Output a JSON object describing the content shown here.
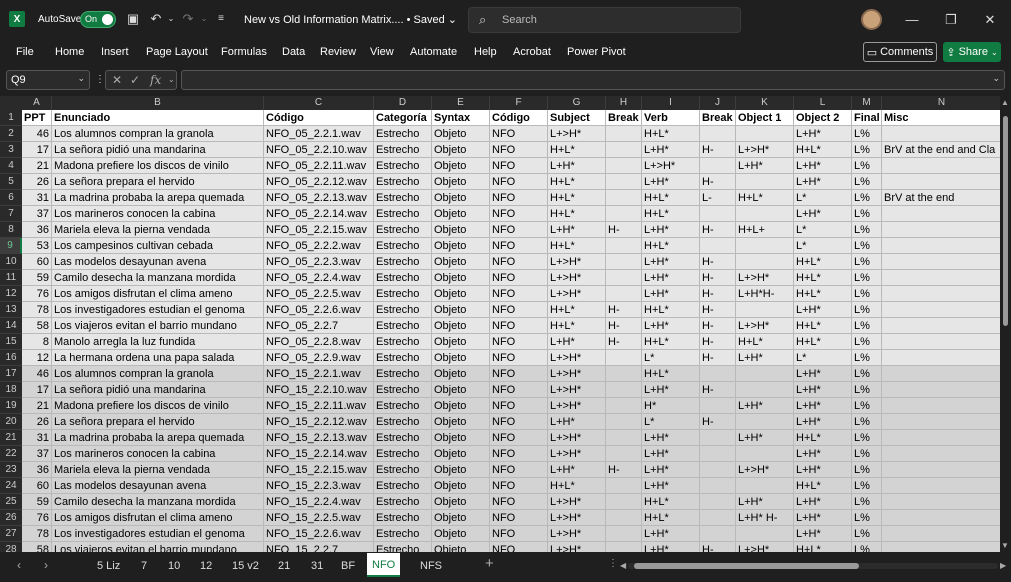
{
  "titlebar": {
    "app_icon": "X",
    "autosave_label": "AutoSave",
    "autosave_state": "On",
    "doc_title": "New vs Old Information Matrix.... • Saved",
    "search_placeholder": "Search"
  },
  "menu": [
    "File",
    "Home",
    "Insert",
    "Page Layout",
    "Formulas",
    "Data",
    "Review",
    "View",
    "Automate",
    "Help",
    "Acrobat",
    "Power Pivot"
  ],
  "actions": {
    "comments": "Comments",
    "share": "Share"
  },
  "formula_bar": {
    "name_box": "Q9",
    "fx": "fx",
    "formula": ""
  },
  "columns": [
    "A",
    "B",
    "C",
    "D",
    "E",
    "F",
    "G",
    "H",
    "I",
    "J",
    "K",
    "L",
    "M",
    "N"
  ],
  "headers": [
    "PPT",
    "Enunciado",
    "Código",
    "Categoría",
    "Syntax",
    "Código",
    "Subject",
    "Break",
    "Verb",
    "Break",
    "Object 1",
    "Object 2",
    "Final",
    "Misc"
  ],
  "rows": [
    [
      "46",
      "Los alumnos compran la granola",
      "NFO_05_2.2.1.wav",
      "Estrecho",
      "Objeto",
      "NFO",
      "L+>H*",
      "",
      "H+L*",
      "",
      "",
      "L+H*",
      "L%",
      ""
    ],
    [
      "17",
      "La señora pidió una mandarina",
      "NFO_05_2.2.10.wav",
      "Estrecho",
      "Objeto",
      "NFO",
      "H+L*",
      "",
      "L+H*",
      "H-",
      "L+>H*",
      "H+L*",
      "L%",
      "BrV at the end and Cla"
    ],
    [
      "21",
      "Madona prefiere los discos de vinilo",
      "NFO_05_2.2.11.wav",
      "Estrecho",
      "Objeto",
      "NFO",
      "L+H*",
      "",
      "L+>H*",
      "",
      "L+H*",
      "L+H*",
      "L%",
      ""
    ],
    [
      "26",
      "La señora prepara el hervido",
      "NFO_05_2.2.12.wav",
      "Estrecho",
      "Objeto",
      "NFO",
      "H+L*",
      "",
      "L+H*",
      "H-",
      "",
      "L+H*",
      "L%",
      ""
    ],
    [
      "31",
      "La madrina probaba la arepa quemada",
      "NFO_05_2.2.13.wav",
      "Estrecho",
      "Objeto",
      "NFO",
      "H+L*",
      "",
      "H+L*",
      "L-",
      "H+L*",
      "L*",
      "L%",
      "BrV  at the end"
    ],
    [
      "37",
      "Los marineros conocen la cabina",
      "NFO_05_2.2.14.wav",
      "Estrecho",
      "Objeto",
      "NFO",
      "H+L*",
      "",
      "H+L*",
      "",
      "",
      "L+H*",
      "L%",
      ""
    ],
    [
      "36",
      "Mariela eleva la pierna vendada",
      "NFO_05_2.2.15.wav",
      "Estrecho",
      "Objeto",
      "NFO",
      "L+H*",
      "H-",
      "L+H*",
      "H-",
      "H+L+",
      "L*",
      "L%",
      ""
    ],
    [
      "53",
      "Los campesinos cultivan cebada",
      "NFO_05_2.2.2.wav",
      "Estrecho",
      "Objeto",
      "NFO",
      "H+L*",
      "",
      "H+L*",
      "",
      "",
      "L*",
      "L%",
      ""
    ],
    [
      "60",
      "Las modelos desayunan avena",
      "NFO_05_2.2.3.wav",
      "Estrecho",
      "Objeto",
      "NFO",
      "L+>H*",
      "",
      "L+H*",
      "H-",
      "",
      "H+L*",
      "L%",
      ""
    ],
    [
      "59",
      "Camilo desecha la manzana mordida",
      "NFO_05_2.2.4.wav",
      "Estrecho",
      "Objeto",
      "NFO",
      "L+>H*",
      "",
      "L+H*",
      "H-",
      "L+>H*",
      "H+L*",
      "L%",
      ""
    ],
    [
      "76",
      "Los amigos disfrutan el clima ameno",
      "NFO_05_2.2.5.wav",
      "Estrecho",
      "Objeto",
      "NFO",
      "L+>H*",
      "",
      "L+H*",
      "H-",
      "L+H*H-",
      "H+L*",
      "L%",
      ""
    ],
    [
      "78",
      "Los investigadores estudian el genoma",
      "NFO_05_2.2.6.wav",
      "Estrecho",
      "Objeto",
      "NFO",
      "H+L*",
      "H-",
      "H+L*",
      "H-",
      "",
      "L+H*",
      "L%",
      ""
    ],
    [
      "58",
      "Los viajeros evitan el barrio mundano",
      "NFO_05_2.2.7",
      "Estrecho",
      "Objeto",
      "NFO",
      "H+L*",
      "H-",
      "L+H*",
      "H-",
      "L+>H*",
      "H+L*",
      "L%",
      ""
    ],
    [
      "8",
      "Manolo arregla la luz fundida",
      "NFO_05_2.2.8.wav",
      "Estrecho",
      "Objeto",
      "NFO",
      "L+H*",
      "H-",
      "H+L*",
      "H-",
      "H+L*",
      "H+L*",
      "L%",
      ""
    ],
    [
      "12",
      "La hermana ordena una papa salada",
      "NFO_05_2.2.9.wav",
      "Estrecho",
      "Objeto",
      "NFO",
      "L+>H*",
      "",
      "L*",
      "H-",
      "L+H*",
      "L*",
      "L%",
      ""
    ],
    [
      "46",
      "Los alumnos compran la granola",
      "NFO_15_2.2.1.wav",
      "Estrecho",
      "Objeto",
      "NFO",
      "L+>H*",
      "",
      "H+L*",
      "",
      "",
      "L+H*",
      "L%",
      ""
    ],
    [
      "17",
      "La señora pidió una mandarina",
      "NFO_15_2.2.10.wav",
      "Estrecho",
      "Objeto",
      "NFO",
      "L+>H*",
      "",
      "L+H*",
      "H-",
      "",
      "L+H*",
      "L%",
      ""
    ],
    [
      "21",
      "Madona prefiere los discos de vinilo",
      "NFO_15_2.2.11.wav",
      "Estrecho",
      "Objeto",
      "NFO",
      "L+>H*",
      "",
      "H*",
      "",
      "L+H*",
      "L+H*",
      "L%",
      ""
    ],
    [
      "26",
      "La señora prepara el hervido",
      "NFO_15_2.2.12.wav",
      "Estrecho",
      "Objeto",
      "NFO",
      "L+H*",
      "",
      "L*",
      "H-",
      "",
      "L+H*",
      "L%",
      ""
    ],
    [
      "31",
      "La madrina probaba la arepa quemada",
      "NFO_15_2.2.13.wav",
      "Estrecho",
      "Objeto",
      "NFO",
      "L+>H*",
      "",
      "L+H*",
      "",
      "L+H*",
      "H+L*",
      "L%",
      ""
    ],
    [
      "37",
      "Los marineros conocen la cabina",
      "NFO_15_2.2.14.wav",
      "Estrecho",
      "Objeto",
      "NFO",
      "L+>H*",
      "",
      "L+H*",
      "",
      "",
      "L+H*",
      "L%",
      ""
    ],
    [
      "36",
      "Mariela eleva la pierna vendada",
      "NFO_15_2.2.15.wav",
      "Estrecho",
      "Objeto",
      "NFO",
      "L+H*",
      "H-",
      "L+H*",
      "",
      "L+>H*",
      "L+H*",
      "L%",
      ""
    ],
    [
      "60",
      "Las modelos desayunan avena",
      "NFO_15_2.2.3.wav",
      "Estrecho",
      "Objeto",
      "NFO",
      "H+L*",
      "",
      "L+H*",
      "",
      "",
      "H+L*",
      "L%",
      ""
    ],
    [
      "59",
      "Camilo desecha la manzana mordida",
      "NFO_15_2.2.4.wav",
      "Estrecho",
      "Objeto",
      "NFO",
      "L+>H*",
      "",
      "H+L*",
      "",
      "L+H*",
      "L+H*",
      "L%",
      ""
    ],
    [
      "76",
      "Los amigos disfrutan el clima ameno",
      "NFO_15_2.2.5.wav",
      "Estrecho",
      "Objeto",
      "NFO",
      "L+>H*",
      "",
      "H+L*",
      "",
      "L+H* H-",
      "L+H*",
      "L%",
      ""
    ],
    [
      "78",
      "Los investigadores estudian el genoma",
      "NFO_15_2.2.6.wav",
      "Estrecho",
      "Objeto",
      "NFO",
      "L+>H*",
      "",
      "L+H*",
      "",
      "",
      "L+H*",
      "L%",
      ""
    ],
    [
      "58",
      "Los viajeros evitan el barrio mundano",
      "NFO_15_2.2.7",
      "Estrecho",
      "Objeto",
      "NFO",
      "L+>H*",
      "",
      "L+H*",
      "H-",
      "L+>H*",
      "H+L*",
      "L%",
      ""
    ]
  ],
  "selected_row": "9",
  "sheet_tabs": [
    "5 Liz",
    "7",
    "10",
    "12",
    "15 v2",
    "21",
    "31",
    "BF",
    "NFO",
    "NFS"
  ],
  "active_tab": "NFO",
  "colors": {
    "accent": "#107c41",
    "group1": "#e6e6e6",
    "group2": "#d3d3d3"
  }
}
